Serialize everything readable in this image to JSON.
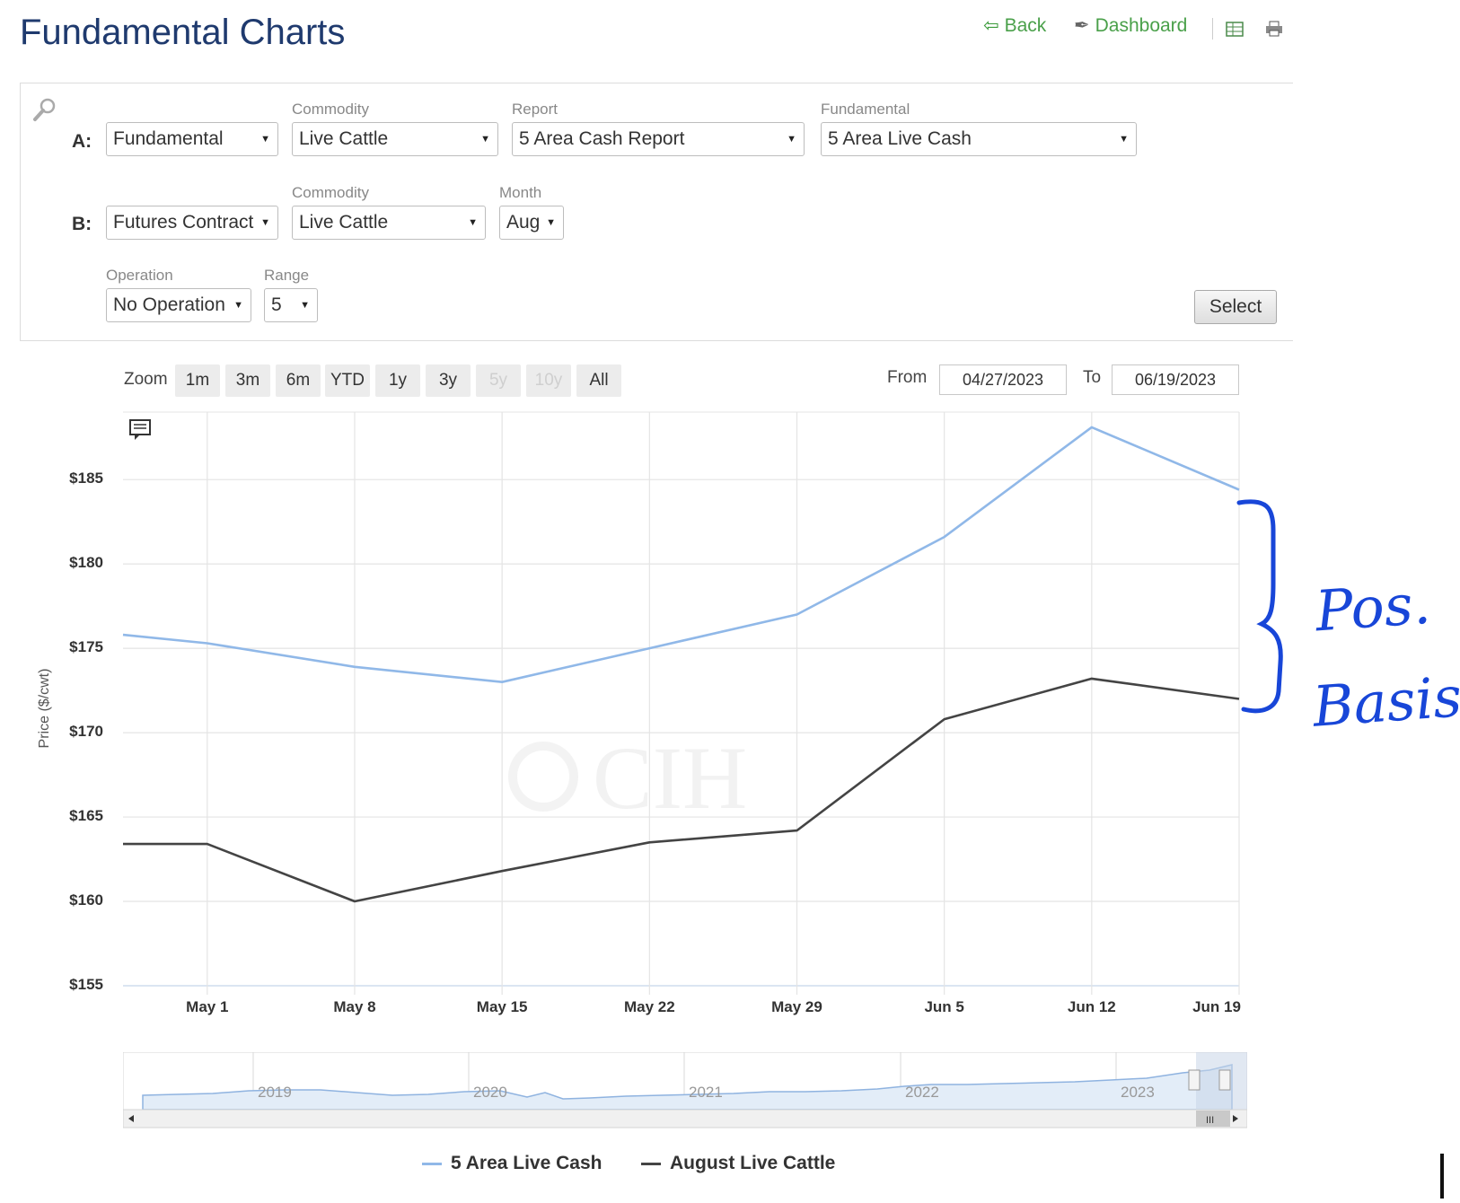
{
  "header": {
    "title": "Fundamental Charts",
    "back_label": "Back",
    "dashboard_label": "Dashboard"
  },
  "selectors": {
    "row_a": {
      "label": "A:",
      "type_value": "Fundamental",
      "commodity_label": "Commodity",
      "commodity_value": "Live Cattle",
      "report_label": "Report",
      "report_value": "5 Area Cash Report",
      "fundamental_label": "Fundamental",
      "fundamental_value": "5 Area Live Cash"
    },
    "row_b": {
      "label": "B:",
      "type_value": "Futures Contract",
      "commodity_label": "Commodity",
      "commodity_value": "Live Cattle",
      "month_label": "Month",
      "month_value": "Aug"
    },
    "operation_label": "Operation",
    "operation_value": "No Operation",
    "range_label": "Range",
    "range_value": "5",
    "select_label": "Select"
  },
  "zoom": {
    "label": "Zoom",
    "buttons": [
      "1m",
      "3m",
      "6m",
      "YTD",
      "1y",
      "3y",
      "5y",
      "10y",
      "All"
    ],
    "disabled": [
      "5y",
      "10y"
    ],
    "from_label": "From",
    "from_value": "04/27/2023",
    "to_label": "To",
    "to_value": "06/19/2023"
  },
  "chart_data": {
    "type": "line",
    "ylabel": "Price ($/cwt)",
    "ylim": [
      155,
      189
    ],
    "y_ticks": [
      "$155",
      "$160",
      "$165",
      "$170",
      "$175",
      "$180",
      "$185"
    ],
    "x_ticks": [
      "May 1",
      "May 8",
      "May 15",
      "May 22",
      "May 29",
      "Jun 5",
      "Jun 12",
      "Jun 19"
    ],
    "grid": true,
    "legend_position": "bottom",
    "watermark": "CIH",
    "series": [
      {
        "name": "5 Area Live Cash",
        "color": "#90b8e8",
        "x": [
          "2023-04-27",
          "2023-05-01",
          "2023-05-08",
          "2023-05-15",
          "2023-05-22",
          "2023-05-29",
          "2023-06-05",
          "2023-06-12",
          "2023-06-19"
        ],
        "values": [
          175.8,
          175.3,
          173.9,
          173.0,
          175.0,
          177.0,
          181.6,
          188.1,
          184.4
        ]
      },
      {
        "name": "August Live Cattle",
        "color": "#444444",
        "x": [
          "2023-04-27",
          "2023-05-01",
          "2023-05-08",
          "2023-05-15",
          "2023-05-22",
          "2023-05-29",
          "2023-06-05",
          "2023-06-12",
          "2023-06-19"
        ],
        "values": [
          163.4,
          163.4,
          160.0,
          161.8,
          163.5,
          164.2,
          170.8,
          173.2,
          172.0
        ]
      }
    ]
  },
  "navigator": {
    "years": [
      "2019",
      "2020",
      "2021",
      "2022",
      "2023"
    ]
  },
  "annotation": {
    "handwritten_line1": "Pos.",
    "handwritten_line2": "Basis",
    "ink_color": "#1846d8"
  }
}
